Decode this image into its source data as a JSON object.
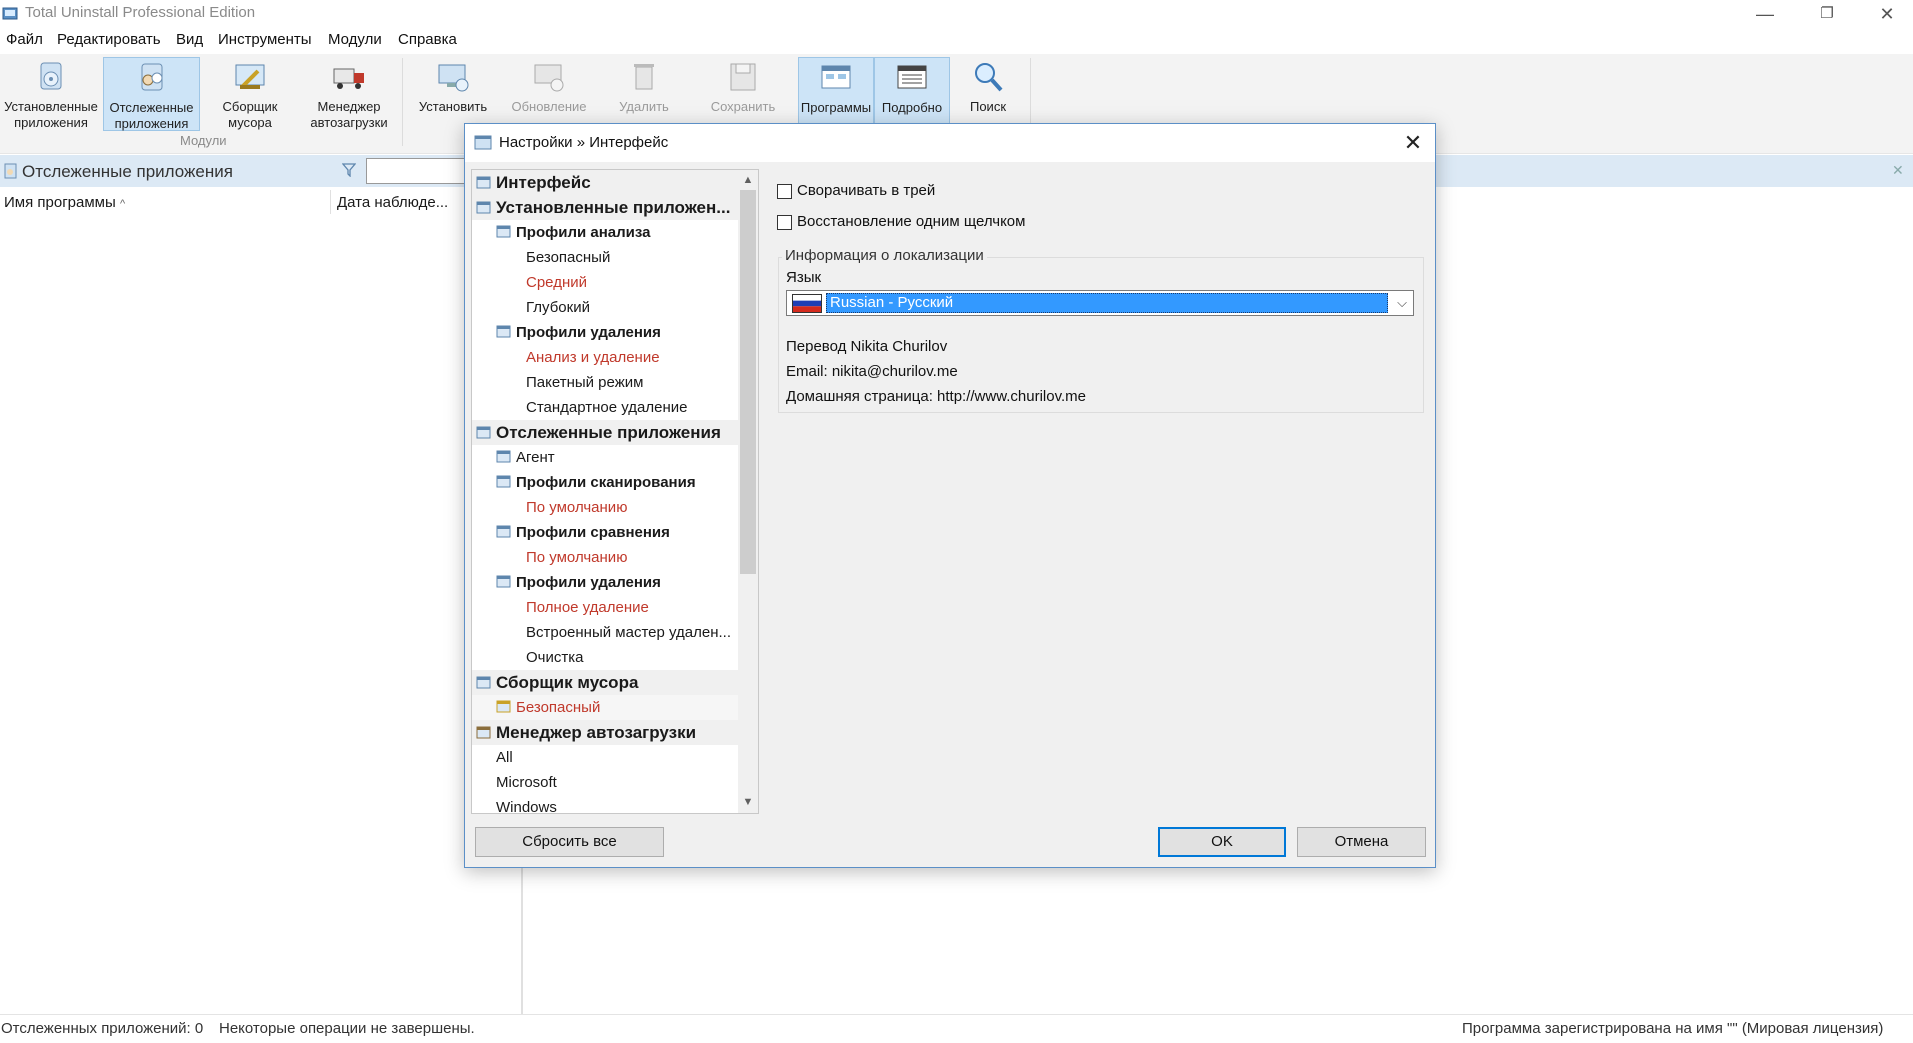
{
  "window": {
    "title": "Total Uninstall Professional Edition",
    "controls": {
      "minimize": "—",
      "restore": "❐",
      "close": "✕"
    }
  },
  "menu": [
    "Файл",
    "Редактировать",
    "Вид",
    "Инструменты",
    "Модули",
    "Справка"
  ],
  "ribbon": {
    "modules": [
      {
        "label": "Установленные приложения",
        "icon": "installed-apps-icon"
      },
      {
        "label": "Отслеженные приложения",
        "icon": "monitored-apps-icon"
      },
      {
        "label": "Сборщик мусора",
        "icon": "junk-collector-icon"
      },
      {
        "label": "Менеджер автозагрузки",
        "icon": "autorun-manager-icon"
      }
    ],
    "modules_group_label": "Модули",
    "actions": [
      {
        "label": "Установить",
        "icon": "install-icon"
      },
      {
        "label": "Обновление",
        "icon": "update-icon"
      },
      {
        "label": "Удалить",
        "icon": "delete-icon"
      },
      {
        "label": "Сохранить",
        "icon": "save-icon"
      },
      {
        "label": "Программы",
        "icon": "programs-icon"
      },
      {
        "label": "Подробно",
        "icon": "details-icon"
      },
      {
        "label": "Поиск",
        "icon": "search-icon"
      }
    ]
  },
  "panel": {
    "title": "Отслеженные приложения",
    "columns": [
      "Имя программы",
      "Дата наблюде..."
    ]
  },
  "status": {
    "left": "Отслеженных приложений: 0",
    "middle": "Некоторые операции не завершены.",
    "right": "Программа зарегистрирована на имя \"\" (Мировая лицензия)"
  },
  "dialog": {
    "title": "Настройки » Интерфейс",
    "close": "✕",
    "tree": [
      {
        "label": "Интерфейс",
        "level": 0,
        "style": "h1"
      },
      {
        "label": "Установленные приложен...",
        "level": 0,
        "style": "h1"
      },
      {
        "label": "Профили анализа",
        "level": 1,
        "style": "h2"
      },
      {
        "label": "Безопасный",
        "level": 2,
        "style": ""
      },
      {
        "label": "Средний",
        "level": 2,
        "style": "red"
      },
      {
        "label": "Глубокий",
        "level": 2,
        "style": ""
      },
      {
        "label": "Профили удаления",
        "level": 1,
        "style": "h2"
      },
      {
        "label": "Анализ и удаление",
        "level": 2,
        "style": "red"
      },
      {
        "label": "Пакетный режим",
        "level": 2,
        "style": ""
      },
      {
        "label": "Стандартное удаление",
        "level": 2,
        "style": ""
      },
      {
        "label": "Отслеженные приложения",
        "level": 0,
        "style": "h1"
      },
      {
        "label": "Агент",
        "level": 1,
        "style": ""
      },
      {
        "label": "Профили сканирования",
        "level": 1,
        "style": "h2"
      },
      {
        "label": "По умолчанию",
        "level": 2,
        "style": "red"
      },
      {
        "label": "Профили сравнения",
        "level": 1,
        "style": "h2"
      },
      {
        "label": "По умолчанию",
        "level": 2,
        "style": "red"
      },
      {
        "label": "Профили удаления",
        "level": 1,
        "style": "h2"
      },
      {
        "label": "Полное удаление",
        "level": 2,
        "style": "red"
      },
      {
        "label": "Встроенный мастер удален...",
        "level": 2,
        "style": ""
      },
      {
        "label": "Очистка",
        "level": 2,
        "style": ""
      },
      {
        "label": "Сборщик мусора",
        "level": 0,
        "style": "h1"
      },
      {
        "label": "Безопасный",
        "level": 1,
        "style": "red sel"
      },
      {
        "label": "Менеджер автозагрузки",
        "level": 0,
        "style": "h1"
      },
      {
        "label": "All",
        "level": 1,
        "style": ""
      },
      {
        "label": "Microsoft",
        "level": 1,
        "style": ""
      },
      {
        "label": "Windows",
        "level": 1,
        "style": ""
      }
    ],
    "options": {
      "minimize_to_tray": "Сворачивать в трей",
      "single_click_restore": "Восстановление одним щелчком"
    },
    "localization": {
      "legend": "Информация о локализации",
      "language_label": "Язык",
      "language_value": "Russian - Русский",
      "translator": "Перевод Nikita Churilov",
      "email": "Email: nikita@churilov.me",
      "homepage": "Домашняя страница: http://www.churilov.me"
    },
    "buttons": {
      "reset": "Сбросить все",
      "ok": "OK",
      "cancel": "Отмена"
    }
  },
  "colors": {
    "accent": "#3399ff",
    "red_text": "#c0392b",
    "panel_header": "#dce9f5",
    "ribbon_active": "#cde4f7"
  }
}
